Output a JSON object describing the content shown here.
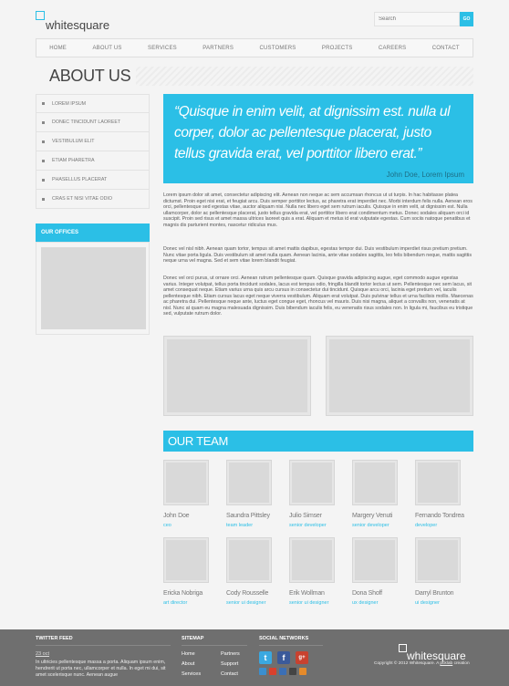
{
  "header": {
    "logo_text": "whitesquare",
    "search_placeholder": "Search",
    "search_button": "GO"
  },
  "nav": [
    "HOME",
    "ABOUT US",
    "SERVICES",
    "PARTNERS",
    "CUSTOMERS",
    "PROJECTS",
    "CAREERS",
    "CONTACT"
  ],
  "page_title": "ABOUT US",
  "sidebar": {
    "items": [
      "LOREM IPSUM",
      "DONEC TINCIDUNT LAOREET",
      "VESTIBULUM ELIT",
      "ETIAM PHARETRA",
      "PHASELLUS PLACERAT",
      "CRAS ET NISI VITAE ODIO"
    ],
    "offices_title": "OUR OFFICES"
  },
  "quote": {
    "text": "“Quisque in enim velit, at dignissim est. nulla ul corper, dolor ac pellentesque placerat, justo tellus gravida erat, vel porttitor libero erat.”",
    "author": "John Doe, Lorem Ipsum"
  },
  "paragraphs": [
    "Lorem ipsum dolor sit amet, consectetur adipiscing elit. Aenean non neque ac sem accumsan rhoncus ut ut turpis. In hac habitasse platea dictumst. Proin eget nisi erat, et feugiat arcu. Duis semper porttitor lectus, ac pharetra erat imperdiet nec. Morbi interdum felis nulla. Aenean eros orci, pellentesque sed egestas vitae, auctor aliquam nisi. Nulla nec libero eget sem rutrum iaculis. Quisque in enim velit, at dignissim est. Nulla ullamcorper, dolor ac pellentesque placerat, justo tellus gravida erat, vel porttitor libero erat condimentum metus. Donec sodales aliquam orci id suscipit. Proin sed risus et amet massa ultrices laoreet quis a erat. Aliquam et metus id erat vulputate egestas. Cum sociis natoque penatibus et magnis dis parturient montes, nascetur ridiculus mus.",
    "Donec vel nisl nibh. Aenean quam tortor, tempus sit amet mattis dapibus, egestas tempor dui. Duis vestibulum imperdiet risus pretium pretium. Nunc vitae porta ligula. Duis vestibulum sit amet nulla quam. Aenean lacinia, ante vitae sodales sagittis, leo felis bibendum neque, mattis sagittis neque urna vel magna. Sed et sem vitae lorem blandit feugiat.",
    "Donec vel orci purus, ut ornare orci. Aenean rutrum pellentesque quam. Quisque gravida adipiscing augue, eget commodo augue egestas varius. Integer volutpat, tellus porta tincidunt sodales, lacus est tempus odio, fringilla blandit tortor lectus ut sem. Pellentesque nec sem lacus, sit amet consequat neque. Etiam varius urna quis arcu cursus in consectetur dui tincidunt. Quisque arcu orci, lacinia eget pretium vel, iaculis pellentesque nibh. Etiam cursus lacus eget neque viverra vestibulum. Aliquam erat volutpat. Duis pulvinar tellus et urna facilisis mollis. Maecenas ac pharetra dui. Pellentesque neque ante, luctus eget congue eget, rhoncus vel mauris. Duis nisi magna, aliquet a convallis non, venenatis at nisl. Nunc at quam eu magna malesuada dignissim. Duis bibendum iaculis felis, eu venenatis risus sodales non. In ligula mi, faucibus eu tristique sed, vulputate rutrum dolor."
  ],
  "team": {
    "title": "OUR TEAM",
    "members": [
      {
        "name": "John Doe",
        "role": "ceo"
      },
      {
        "name": "Saundra Pittsley",
        "role": "team leader"
      },
      {
        "name": "Julio Simser",
        "role": "senior developer"
      },
      {
        "name": "Margery Venuti",
        "role": "senior developer"
      },
      {
        "name": "Fernando Tondrea",
        "role": "developer"
      },
      {
        "name": "Ericka Nobriga",
        "role": "art director"
      },
      {
        "name": "Cody Rousselle",
        "role": "senior ui designer"
      },
      {
        "name": "Erik Wollman",
        "role": "senior ui designer"
      },
      {
        "name": "Dona Shoff",
        "role": "ux designer"
      },
      {
        "name": "Darryl Brunton",
        "role": "ui designer"
      }
    ]
  },
  "footer": {
    "twitter_title": "TWITTER FEED",
    "tweet_date": "23 oct",
    "tweet_text": "In ultricies pellentesque massa a porta. Aliquam ipsum enim, hendrerit ut porta nec, ullamcorper et nulla. In eget mi dui, sit amet scelerisque nunc. Aenean augue",
    "sitemap_title": "SITEMAP",
    "sitemap": [
      "Home",
      "Partners",
      "About",
      "Support",
      "Services",
      "Contact"
    ],
    "social_title": "SOCIAL NETWORKS",
    "logo_text": "whitesquare",
    "copyright": "Copyright © 2012 Whitesquare. A",
    "copyright_link": "pcklab",
    "copyright_end": "creation"
  },
  "colors": {
    "accent": "#2bbfe6",
    "footer_bg": "#6f6f6f"
  }
}
